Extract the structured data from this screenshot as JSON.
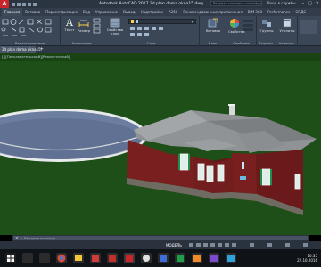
{
  "window": {
    "app_logo": "A",
    "title": "Autodesk AutoCAD 2017   3d plan doma okna15.dwg",
    "search_placeholder": "Введите ключевое слово/фразу",
    "login": "Вход в службы"
  },
  "tabs": [
    "Главная",
    "Вставка",
    "Параметризация",
    "Вид",
    "Управление",
    "Вывод",
    "Надстройки",
    "A360",
    "Рекомендованные приложения",
    "BIM 360",
    "Performance",
    "СПДС"
  ],
  "active_tab": "Главная",
  "ribbon": {
    "groups": [
      {
        "label": "Редактирование"
      },
      {
        "label": "Аннотации"
      },
      {
        "label": "Слои"
      },
      {
        "label": "Блок"
      },
      {
        "label": "Свойства"
      },
      {
        "label": "Группы"
      },
      {
        "label": "Утилиты"
      }
    ],
    "buttons": {
      "text": "Текст",
      "dimension": "Размер",
      "layer_props": "Свойства слоя",
      "insert": "Вставка",
      "properties": "Свойства",
      "groups": "Группы",
      "utilities": "Утилиты"
    }
  },
  "doc_tab": "3d plan doma okna15*",
  "viewport_label": "[-][Пользовательский][Реалистичный]",
  "command": {
    "prompt": "Введите команду"
  },
  "status": {
    "model": "МОДЕЛЬ"
  },
  "clock": {
    "time": "10:35",
    "date": "22.10.2016"
  },
  "colors": {
    "sky": "#dfe2e3",
    "grass": "#1f4f18",
    "wall": "#7a1f1f",
    "roof": "#8f9396",
    "water": "#6b7da0"
  }
}
